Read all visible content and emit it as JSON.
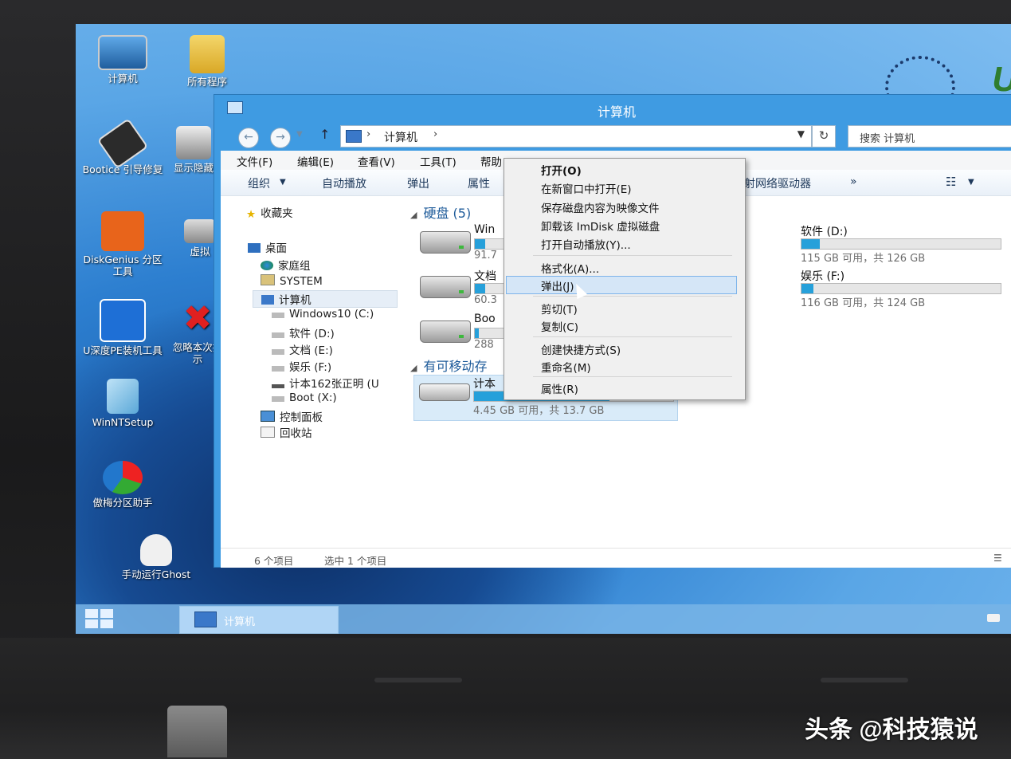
{
  "desktop": {
    "icons": [
      {
        "label": "计算机",
        "icon": "computer-icon"
      },
      {
        "label": "所有程序",
        "icon": "folder-icon"
      },
      {
        "label": "Bootice 引导修复",
        "icon": "floppy-icon"
      },
      {
        "label": "显示隐藏",
        "icon": "disk-icon"
      },
      {
        "label": "DiskGenius 分区工具",
        "icon": "diskgenius-icon"
      },
      {
        "label": "虚拟",
        "icon": "drive-icon"
      },
      {
        "label": "U深度PE装机工具",
        "icon": "ghost-installer-icon"
      },
      {
        "label": "忽略本次提示",
        "icon": "x-icon"
      },
      {
        "label": "WinNTSetup",
        "icon": "winntsetup-icon"
      },
      {
        "label": "傲梅分区助手",
        "icon": "partition-assistant-icon"
      },
      {
        "label": "手动运行Ghost",
        "icon": "ghost-icon"
      }
    ],
    "brand_logo": "U"
  },
  "taskbar": {
    "task_label": "计算机"
  },
  "window": {
    "title": "计算机",
    "address": {
      "path_item": "计算机",
      "search_placeholder": "搜索 计算机"
    },
    "menubar": [
      "文件(F)",
      "编辑(E)",
      "查看(V)",
      "工具(T)",
      "帮助"
    ],
    "toolbar": [
      "组织",
      "自动播放",
      "弹出",
      "属性",
      "射网络驱动器",
      "»"
    ],
    "nav": {
      "favorites": "收藏夹",
      "desktop": "桌面",
      "homegroup": "家庭组",
      "system": "SYSTEM",
      "computer": "计算机",
      "drives": [
        "Windows10 (C:)",
        "软件 (D:)",
        "文档 (E:)",
        "娱乐 (F:)",
        "计本162张正明 (U",
        "Boot (X:)"
      ],
      "control_panel": "控制面板",
      "recycle_bin": "回收站"
    },
    "groups": {
      "hdd_header": "硬盘 (5)",
      "removable_header": "有可移动存"
    },
    "drives": [
      {
        "name": "Win",
        "free": "91.7",
        "used_fraction": 0.05
      },
      {
        "name": "文档",
        "free": "60.3",
        "used_fraction": 0.05
      },
      {
        "name": "Boo",
        "free": "288",
        "used_fraction": 0.02
      },
      {
        "name": "软件 (D:)",
        "free": "115 GB 可用，共 126 GB",
        "used_fraction": 0.09
      },
      {
        "name": "娱乐 (F:)",
        "free": "116 GB 可用，共 124 GB",
        "used_fraction": 0.06
      },
      {
        "name": "计本",
        "free": "4.45 GB 可用，共 13.7 GB",
        "used_fraction": 0.68
      }
    ],
    "status": {
      "items": "6 个项目",
      "selected": "选中 1 个项目"
    }
  },
  "context_menu": {
    "items": [
      {
        "label": "打开(O)",
        "bold": true
      },
      {
        "label": "在新窗口中打开(E)"
      },
      {
        "label": "保存磁盘内容为映像文件"
      },
      {
        "label": "卸载该 ImDisk 虚拟磁盘"
      },
      {
        "label": "打开自动播放(Y)..."
      },
      {
        "label": "格式化(A)..."
      },
      {
        "label": "弹出(J)",
        "highlighted": true
      },
      {
        "label": "剪切(T)"
      },
      {
        "label": "复制(C)"
      },
      {
        "label": "创建快捷方式(S)"
      },
      {
        "label": "重命名(M)"
      },
      {
        "label": "属性(R)"
      }
    ]
  },
  "watermark": "头条 @科技猿说",
  "colors": {
    "accent": "#3f9be2",
    "usage_bar": "#26a0da",
    "menu_highlight": "#d5e6f7"
  }
}
